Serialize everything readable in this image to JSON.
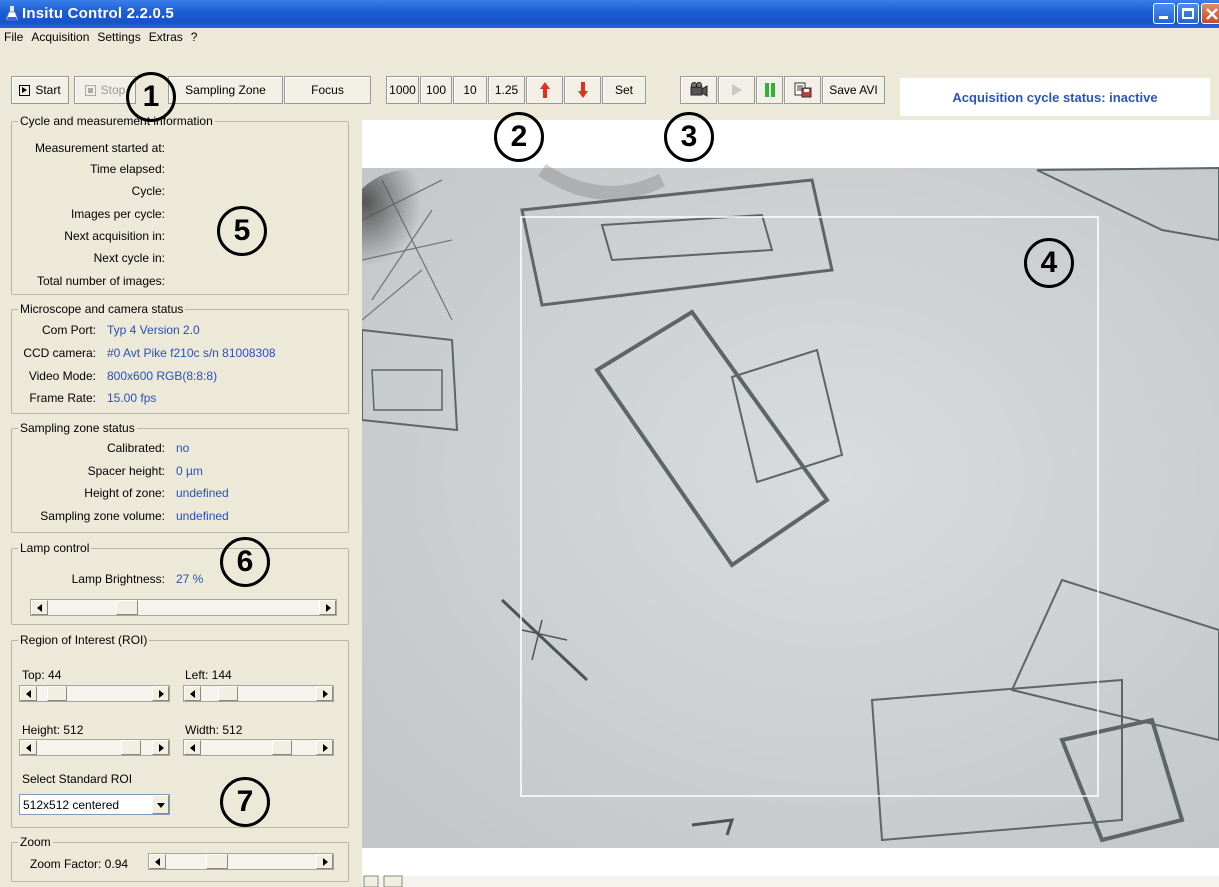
{
  "window": {
    "title": "Insitu Control 2.2.0.5"
  },
  "menu": [
    "File",
    "Acquisition",
    "Settings",
    "Extras",
    "?"
  ],
  "toolbar": {
    "start": "Start",
    "stop": "Stop",
    "sampling_zone": "Sampling Zone",
    "focus": "Focus",
    "steps": [
      "1000",
      "100",
      "10",
      "1.25"
    ],
    "set": "Set",
    "save_avi": "Save AVI",
    "status": "Acquisition cycle status: inactive"
  },
  "cycle": {
    "title": "Cycle and measurement information",
    "rows": [
      "Measurement started at:",
      "Time elapsed:",
      "Cycle:",
      "Images per cycle:",
      "Next acquisition in:",
      "Next cycle in:",
      "Total number of images:"
    ]
  },
  "microscope": {
    "title": "Microscope and camera status",
    "rows": [
      {
        "label": "Com Port:",
        "value": "Typ 4 Version 2.0"
      },
      {
        "label": "CCD camera:",
        "value": "#0  Avt Pike f210c  s/n 81008308"
      },
      {
        "label": "Video Mode:",
        "value": "800x600 RGB(8:8:8)"
      },
      {
        "label": "Frame Rate:",
        "value": "15.00 fps"
      }
    ]
  },
  "sampling": {
    "title": "Sampling zone status",
    "rows": [
      {
        "label": "Calibrated:",
        "value": "no"
      },
      {
        "label": "Spacer height:",
        "value": "0 µm"
      },
      {
        "label": "Height of zone:",
        "value": "undefined"
      },
      {
        "label": "Sampling zone volume:",
        "value": "undefined"
      }
    ]
  },
  "lamp": {
    "title": "Lamp control",
    "label": "Lamp Brightness:",
    "value": "27 %",
    "level": 0.27
  },
  "roi": {
    "title": "Region of Interest (ROI)",
    "top": "Top: 44",
    "left": "Left: 144",
    "height": "Height: 512",
    "width": "Width: 512",
    "select_label": "Select Standard ROI",
    "select_value": "512x512 centered"
  },
  "zoom": {
    "title": "Zoom",
    "label": "Zoom Factor: 0.94"
  },
  "annotations": [
    "1",
    "2",
    "3",
    "4",
    "5",
    "6",
    "7"
  ],
  "colors": {
    "value_text": "#2a4fb8",
    "status_text": "#2a55b8",
    "up_arrow": "#e03020",
    "pause": "#2fb33a"
  }
}
